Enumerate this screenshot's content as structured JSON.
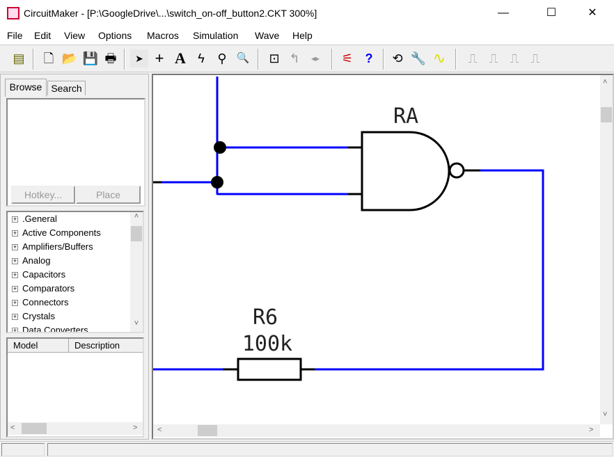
{
  "window": {
    "title": "CircuitMaker - [P:\\GoogleDrive\\...\\switch_on-off_button2.CKT 300%]",
    "minimize": "—",
    "maximize": "☐",
    "close": "✕"
  },
  "menu": [
    "File",
    "Edit",
    "View",
    "Options",
    "Macros",
    "Simulation",
    "Wave",
    "Help"
  ],
  "toolbar": [
    {
      "icon": "parts-icon",
      "g": "▤"
    },
    {
      "icon": "new-file-icon",
      "g": "🗋"
    },
    {
      "icon": "open-folder-icon",
      "g": "📂"
    },
    {
      "icon": "save-icon",
      "g": "💾"
    },
    {
      "icon": "print-icon",
      "g": "🖶"
    },
    {
      "icon": "arrow-pointer-icon",
      "g": "➤"
    },
    {
      "icon": "wire-cross-icon",
      "g": "+"
    },
    {
      "icon": "text-icon",
      "g": "A"
    },
    {
      "icon": "lightning-icon",
      "g": "ϟ"
    },
    {
      "icon": "probe-icon",
      "g": "⚲"
    },
    {
      "icon": "zoom-icon",
      "g": "🔍"
    },
    {
      "icon": "zoom-fit-icon",
      "g": "⊡"
    },
    {
      "icon": "rotate-icon",
      "g": "↰"
    },
    {
      "icon": "mirror-icon",
      "g": "◂▸"
    },
    {
      "icon": "netlist-icon",
      "g": "⚟"
    },
    {
      "icon": "help-icon",
      "g": "?"
    },
    {
      "icon": "reset-icon",
      "g": "⟲"
    },
    {
      "icon": "wrench-icon",
      "g": "🔧"
    },
    {
      "icon": "run-wave-icon",
      "g": "∿"
    },
    {
      "icon": "digital-sim-icon",
      "g": "⎍"
    },
    {
      "icon": "trace-icon",
      "g": "⎍"
    },
    {
      "icon": "analog-sim-icon",
      "g": "⎍"
    },
    {
      "icon": "waveform-icon",
      "g": "⎍"
    }
  ],
  "left": {
    "tabs": [
      "Browse",
      "Search"
    ],
    "hotkey": "Hotkey...",
    "place": "Place",
    "tree": [
      ".General",
      "Active Components",
      "Amplifiers/Buffers",
      "Analog",
      "Capacitors",
      "Comparators",
      "Connectors",
      "Crystals",
      "Data Converters"
    ],
    "columns": [
      "Model",
      "Description"
    ]
  },
  "schematic": {
    "gate_label": "RA",
    "resistor_name": "R6",
    "resistor_value": "100k",
    "wire_color": "#0000ff"
  }
}
